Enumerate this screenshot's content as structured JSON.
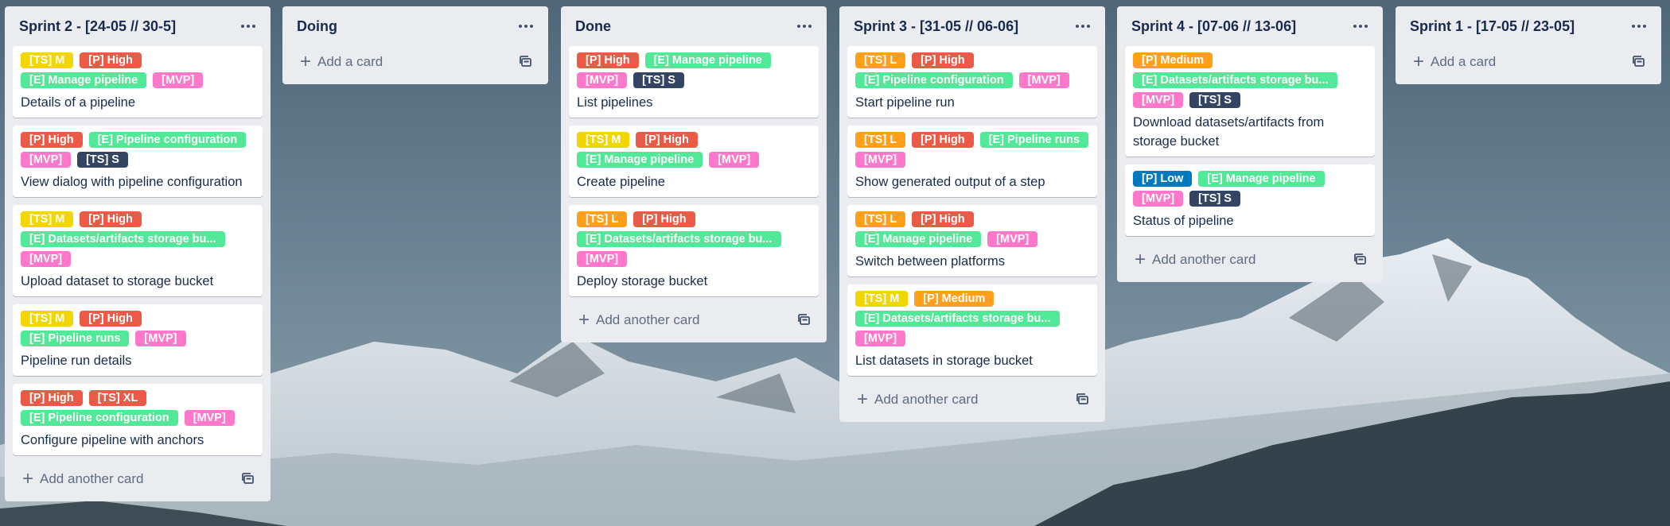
{
  "board": {
    "lists": [
      {
        "title": "Sprint 2 - [24-05 // 30-5]",
        "add_label": "Add another card",
        "cards": [
          {
            "labels": [
              {
                "text": "[TS] M",
                "color": "yellow"
              },
              {
                "text": "[P] High",
                "color": "red"
              },
              {
                "text": "[E] Manage pipeline",
                "color": "lime"
              },
              {
                "text": "[MVP]",
                "color": "pink"
              }
            ],
            "title": "Details of a pipeline"
          },
          {
            "labels": [
              {
                "text": "[P] High",
                "color": "red"
              },
              {
                "text": "[E] Pipeline configuration",
                "color": "lime"
              },
              {
                "text": "[MVP]",
                "color": "pink"
              },
              {
                "text": "[TS] S",
                "color": "navy"
              }
            ],
            "title": "View dialog with pipeline configuration"
          },
          {
            "labels": [
              {
                "text": "[TS] M",
                "color": "yellow"
              },
              {
                "text": "[P] High",
                "color": "red"
              },
              {
                "text": "[E] Datasets/artifacts storage bu...",
                "color": "lime"
              },
              {
                "text": "[MVP]",
                "color": "pink"
              }
            ],
            "title": "Upload dataset to storage bucket"
          },
          {
            "labels": [
              {
                "text": "[TS] M",
                "color": "yellow"
              },
              {
                "text": "[P] High",
                "color": "red"
              },
              {
                "text": "[E] Pipeline runs",
                "color": "lime"
              },
              {
                "text": "[MVP]",
                "color": "pink"
              }
            ],
            "title": "Pipeline run details"
          },
          {
            "labels": [
              {
                "text": "[P] High",
                "color": "red"
              },
              {
                "text": "[TS] XL",
                "color": "red"
              },
              {
                "text": "[E] Pipeline configuration",
                "color": "lime"
              },
              {
                "text": "[MVP]",
                "color": "pink"
              }
            ],
            "title": "Configure pipeline with anchors"
          }
        ]
      },
      {
        "title": "Doing",
        "add_label": "Add a card",
        "cards": []
      },
      {
        "title": "Done",
        "add_label": "Add another card",
        "cards": [
          {
            "labels": [
              {
                "text": "[P] High",
                "color": "red"
              },
              {
                "text": "[E] Manage pipeline",
                "color": "lime"
              },
              {
                "text": "[MVP]",
                "color": "pink"
              },
              {
                "text": "[TS] S",
                "color": "navy"
              }
            ],
            "title": "List pipelines"
          },
          {
            "labels": [
              {
                "text": "[TS] M",
                "color": "yellow"
              },
              {
                "text": "[P] High",
                "color": "red"
              },
              {
                "text": "[E] Manage pipeline",
                "color": "lime"
              },
              {
                "text": "[MVP]",
                "color": "pink"
              }
            ],
            "title": "Create pipeline"
          },
          {
            "labels": [
              {
                "text": "[TS] L",
                "color": "orange"
              },
              {
                "text": "[P] High",
                "color": "red"
              },
              {
                "text": "[E] Datasets/artifacts storage bu...",
                "color": "lime"
              },
              {
                "text": "[MVP]",
                "color": "pink"
              }
            ],
            "title": "Deploy storage bucket"
          }
        ]
      },
      {
        "title": "Sprint 3 - [31-05 // 06-06]",
        "add_label": "Add another card",
        "cards": [
          {
            "labels": [
              {
                "text": "[TS] L",
                "color": "orange"
              },
              {
                "text": "[P] High",
                "color": "red"
              },
              {
                "text": "[E] Pipeline configuration",
                "color": "lime"
              },
              {
                "text": "[MVP]",
                "color": "pink"
              }
            ],
            "title": "Start pipeline run"
          },
          {
            "labels": [
              {
                "text": "[TS] L",
                "color": "orange"
              },
              {
                "text": "[P] High",
                "color": "red"
              },
              {
                "text": "[E] Pipeline runs",
                "color": "lime"
              },
              {
                "text": "[MVP]",
                "color": "pink"
              }
            ],
            "title": "Show generated output of a step"
          },
          {
            "labels": [
              {
                "text": "[TS] L",
                "color": "orange"
              },
              {
                "text": "[P] High",
                "color": "red"
              },
              {
                "text": "[E] Manage pipeline",
                "color": "lime"
              },
              {
                "text": "[MVP]",
                "color": "pink"
              }
            ],
            "title": "Switch between platforms"
          },
          {
            "labels": [
              {
                "text": "[TS] M",
                "color": "yellow"
              },
              {
                "text": "[P] Medium",
                "color": "orange"
              },
              {
                "text": "[E] Datasets/artifacts storage bu...",
                "color": "lime"
              },
              {
                "text": "[MVP]",
                "color": "pink"
              }
            ],
            "title": "List datasets in storage bucket"
          }
        ]
      },
      {
        "title": "Sprint 4 - [07-06 // 13-06]",
        "add_label": "Add another card",
        "cards": [
          {
            "labels": [
              {
                "text": "[P] Medium",
                "color": "orange"
              },
              {
                "text": "[E] Datasets/artifacts storage bu...",
                "color": "lime"
              },
              {
                "text": "[MVP]",
                "color": "pink"
              },
              {
                "text": "[TS] S",
                "color": "navy"
              }
            ],
            "title": "Download datasets/artifacts from storage bucket"
          },
          {
            "labels": [
              {
                "text": "[P] Low",
                "color": "blue"
              },
              {
                "text": "[E] Manage pipeline",
                "color": "lime"
              },
              {
                "text": "[MVP]",
                "color": "pink"
              },
              {
                "text": "[TS] S",
                "color": "navy"
              }
            ],
            "title": "Status of pipeline"
          }
        ]
      },
      {
        "title": "Sprint 1 - [17-05 // 23-05]",
        "add_label": "Add a card",
        "cards": []
      }
    ]
  }
}
